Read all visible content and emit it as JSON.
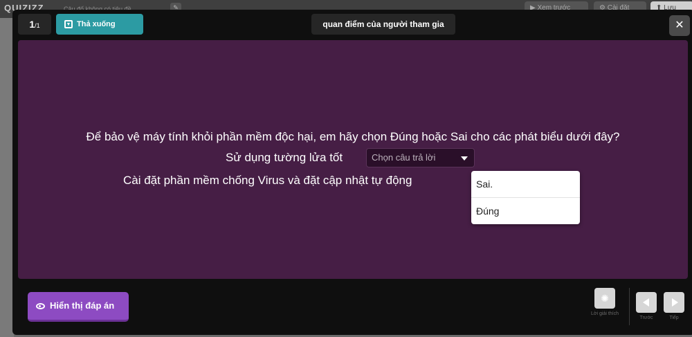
{
  "background": {
    "logo": "QUIZIZZ",
    "title_placeholder": "Câu đố không có tiêu đề",
    "edit_icon": "pencil-icon",
    "buttons": {
      "preview": "Xem trước",
      "settings": "Cài đặt",
      "save": "Lưu"
    }
  },
  "modal": {
    "counter": {
      "current": "1",
      "total": "/1"
    },
    "question_type": {
      "label": "Thả xuống",
      "icon": "dropdown-icon"
    },
    "poll_tag": "quan điểm của người tham gia",
    "close_icon": "close-icon",
    "question": {
      "text": "Để bảo vệ máy tính khỏi phần mềm độc hại, em hãy chọn Đúng hoặc Sai cho các phát biểu dưới đây?",
      "statement_1": "Sử dụng tường lửa tốt",
      "statement_2": "Cài đặt phần mềm chống Virus và đặt cập nhật tự động",
      "select_placeholder": "Chọn câu trả lời",
      "dropdown_options": [
        "Sai.",
        "Đúng"
      ]
    },
    "footer": {
      "show_answer": "Hiển thị đáp án",
      "hint_label": "Lời giải thích",
      "prev_label": "Trước",
      "next_label": "Tiếp"
    }
  },
  "colors": {
    "content_bg": "#461e45",
    "type_button": "#2c9ba3",
    "show_answer_button": "#8d4bc2",
    "modal_bg": "#0f0f0f"
  }
}
